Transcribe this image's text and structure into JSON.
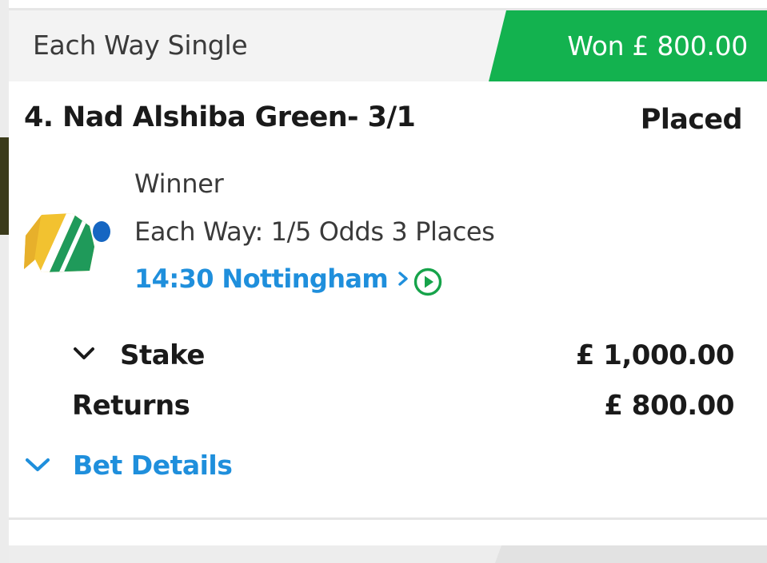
{
  "bet": {
    "type": "Each Way Single",
    "status_label": "Won £ 800.00",
    "selection": "4. Nad Alshiba Green- 3/1",
    "result": "Placed",
    "market": "Winner",
    "each_way_terms": "Each Way: 1/5 Odds 3 Places",
    "event_link": "14:30 Nottingham",
    "stake_label": "Stake",
    "stake_value": "£ 1,000.00",
    "returns_label": "Returns",
    "returns_value": "£ 800.00",
    "details_label": "Bet Details"
  },
  "colors": {
    "won": "#13b24f",
    "link": "#1f8fdc",
    "play_icon": "#16a34a",
    "header_bg": "#f3f3f3"
  },
  "icons": {
    "silks": "jockey-silks-icon",
    "play": "play-circle-icon",
    "link_arrow": "chevron-right-icon",
    "expand": "chevron-down-icon"
  }
}
